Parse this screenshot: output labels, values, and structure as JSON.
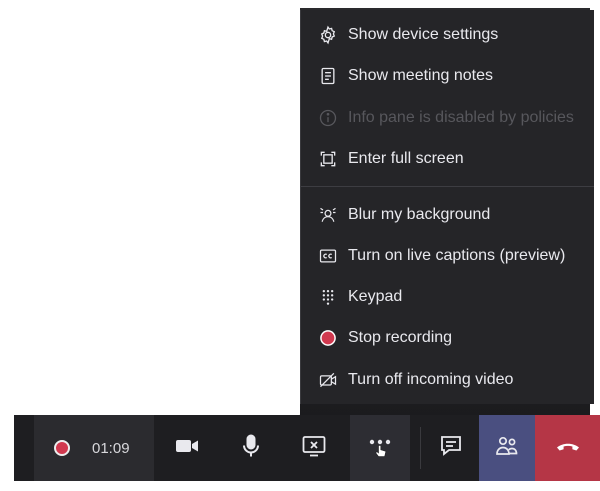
{
  "menu": {
    "items": [
      {
        "label": "Show device settings",
        "icon": "gear-icon",
        "enabled": true
      },
      {
        "label": "Show meeting notes",
        "icon": "notes-icon",
        "enabled": true
      },
      {
        "label": "Info pane is disabled by policies",
        "icon": "info-icon",
        "enabled": false
      },
      {
        "label": "Enter full screen",
        "icon": "fullscreen-icon",
        "enabled": true
      },
      {
        "label": "Blur my background",
        "icon": "blur-background-icon",
        "enabled": true
      },
      {
        "label": "Turn on live captions (preview)",
        "icon": "captions-icon",
        "enabled": true
      },
      {
        "label": "Keypad",
        "icon": "keypad-icon",
        "enabled": true
      },
      {
        "label": "Stop recording",
        "icon": "record-stop-icon",
        "enabled": true
      },
      {
        "label": "Turn off incoming video",
        "icon": "video-off-icon",
        "enabled": true
      }
    ]
  },
  "toolbar": {
    "timer": "01:09",
    "buttons": [
      {
        "name": "camera",
        "icon": "camera-icon"
      },
      {
        "name": "microphone",
        "icon": "microphone-icon"
      },
      {
        "name": "share",
        "icon": "share-screen-icon"
      },
      {
        "name": "more",
        "icon": "more-actions-icon"
      },
      {
        "name": "chat",
        "icon": "chat-icon"
      },
      {
        "name": "participants",
        "icon": "people-icon"
      },
      {
        "name": "hang-up",
        "icon": "hang-up-icon"
      }
    ]
  },
  "colors": {
    "menu_bg": "#252528",
    "toolbar_bg": "#1e1e21",
    "record_red": "#d1394f",
    "people_button": "#4a4f80",
    "hangup_button": "#b53646",
    "disabled_text": "#57575c"
  }
}
